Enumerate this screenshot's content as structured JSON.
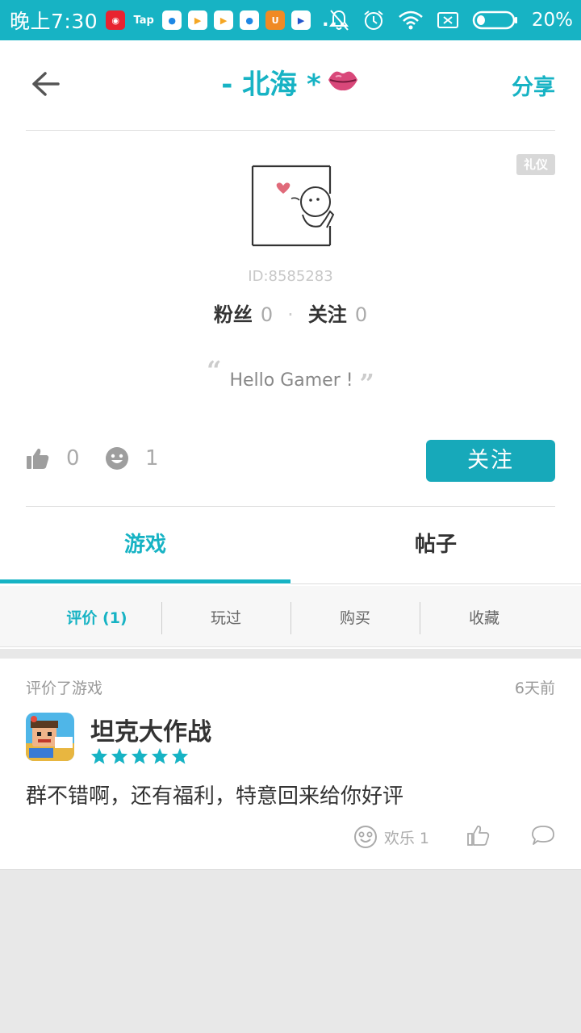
{
  "status_bar": {
    "time": "晚上7:30",
    "apps": [
      "netease-music",
      "tap",
      "browser",
      "play",
      "play",
      "browser",
      "uc",
      "video"
    ],
    "tap_label": "Tap",
    "more": "...",
    "battery_percent": "20%"
  },
  "header": {
    "nickname": "-  北海  *",
    "share_label": "分享",
    "back_icon": "arrow-left-icon",
    "nickname_emoji": "kiss-lips-icon"
  },
  "profile": {
    "badge": "礼仪",
    "user_id": "ID:8585283",
    "fans_label": "粉丝",
    "fans_count": "0",
    "following_label": "关注",
    "following_count": "0",
    "bio": "Hello Gamer !",
    "likes_count": "0",
    "fun_count": "1",
    "follow_button": "关注"
  },
  "tabs": {
    "items": [
      {
        "label": "游戏",
        "active": true
      },
      {
        "label": "帖子",
        "active": false
      }
    ]
  },
  "subtabs": {
    "items": [
      {
        "label": "评价 (1)",
        "active": true
      },
      {
        "label": "玩过",
        "active": false
      },
      {
        "label": "购买",
        "active": false
      },
      {
        "label": "收藏",
        "active": false
      }
    ]
  },
  "review": {
    "action": "评价了游戏",
    "time": "6天前",
    "game_title": "坦克大作战",
    "rating": 5,
    "content": "群不错啊，还有福利，特意回来给你好评",
    "fun_label": "欢乐 1"
  },
  "colors": {
    "accent": "#17b3c4",
    "button": "#17a9ba",
    "background": "#e8e8e8"
  }
}
